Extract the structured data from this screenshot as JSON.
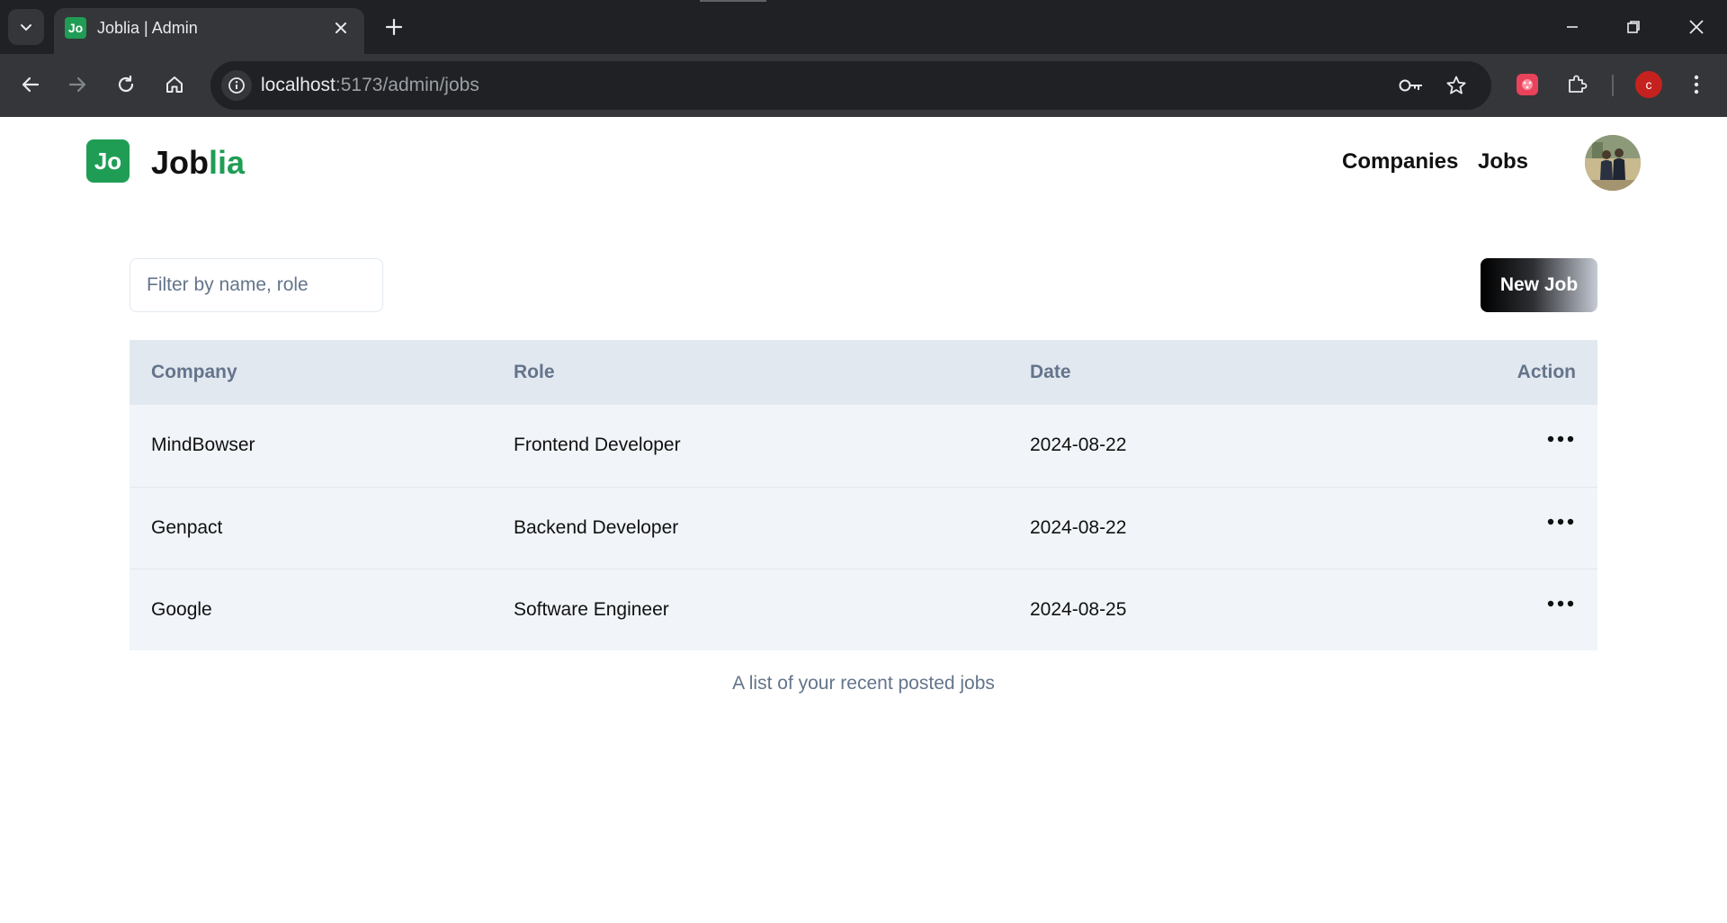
{
  "browser": {
    "tab_title": "Joblia | Admin",
    "tab_favicon_text": "Jo",
    "url_host": "localhost",
    "url_path": ":5173/admin/jobs",
    "profile_initial": "c"
  },
  "header": {
    "logo_text": "Jo",
    "brand_primary": "Job",
    "brand_accent": "lia",
    "nav": [
      "Companies",
      "Jobs"
    ]
  },
  "controls": {
    "filter_placeholder": "Filter by name, role",
    "filter_value": "",
    "new_job_label": "New Job"
  },
  "table": {
    "columns": [
      "Company",
      "Role",
      "Date",
      "Action"
    ],
    "rows": [
      {
        "company": "MindBowser",
        "role": "Frontend Developer",
        "date": "2024-08-22"
      },
      {
        "company": "Genpact",
        "role": "Backend Developer",
        "date": "2024-08-22"
      },
      {
        "company": "Google",
        "role": "Software Engineer",
        "date": "2024-08-25"
      }
    ],
    "caption": "A list of your recent posted jobs"
  },
  "colors": {
    "brand_green": "#1f9d55",
    "header_bg": "#e2e8f0",
    "row_bg": "#f1f5f9",
    "muted_text": "#64748b"
  }
}
